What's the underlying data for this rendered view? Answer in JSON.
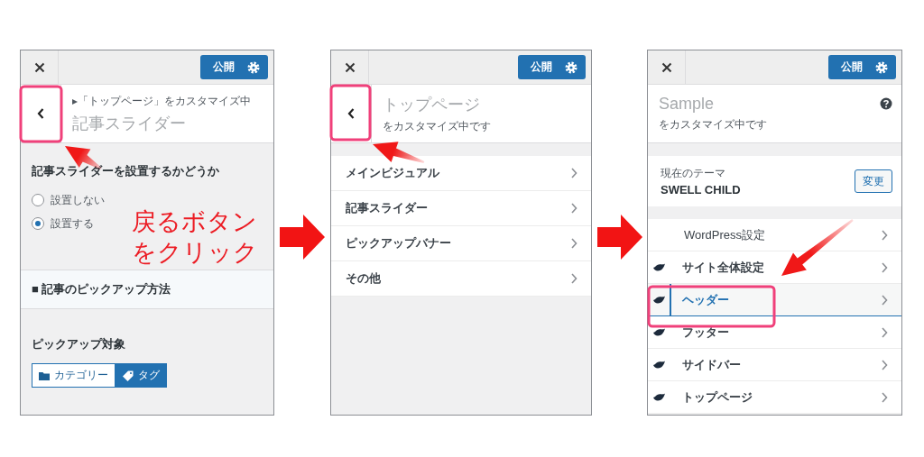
{
  "panels": [
    {
      "kind": "section",
      "publish": "公開",
      "breadcrumb": "▸「トップページ」をカスタマイズ中",
      "title": "記事スライダー",
      "question": "記事スライダーを設置するかどうか",
      "radios": [
        {
          "label": "設置しない",
          "selected": false
        },
        {
          "label": "設置する",
          "selected": true
        }
      ],
      "subsection": "■ 記事のピックアップ方法",
      "field_label": "ピックアップ対象",
      "segments": [
        {
          "label": "カテゴリー",
          "kind": "folder",
          "selected": false
        },
        {
          "label": "タグ",
          "kind": "tag",
          "selected": true
        }
      ]
    },
    {
      "kind": "menu",
      "publish": "公開",
      "title": "トップページ",
      "subtitle": "をカスタマイズ中です",
      "items": [
        {
          "label": "メインビジュアル",
          "selected": false
        },
        {
          "label": "記事スライダー",
          "selected": false
        },
        {
          "label": "ピックアップバナー",
          "selected": false
        },
        {
          "label": "その他",
          "selected": false
        }
      ]
    },
    {
      "kind": "root",
      "publish": "公開",
      "title": "Sample",
      "subtitle": "をカスタマイズ中です",
      "theme_label": "現在のテーマ",
      "theme_name": "SWELL CHILD",
      "change": "変更",
      "items": [
        {
          "label": "WordPress設定",
          "kind": "core",
          "selected": false
        },
        {
          "label": "サイト全体設定",
          "kind": "theme",
          "selected": false
        },
        {
          "label": "ヘッダー",
          "kind": "theme",
          "selected": true
        },
        {
          "label": "フッター",
          "kind": "theme",
          "selected": false
        },
        {
          "label": "サイドバー",
          "kind": "theme",
          "selected": false
        },
        {
          "label": "トップページ",
          "kind": "theme",
          "selected": false
        }
      ]
    }
  ],
  "callout": [
    "戻るボタン",
    "をクリック"
  ]
}
